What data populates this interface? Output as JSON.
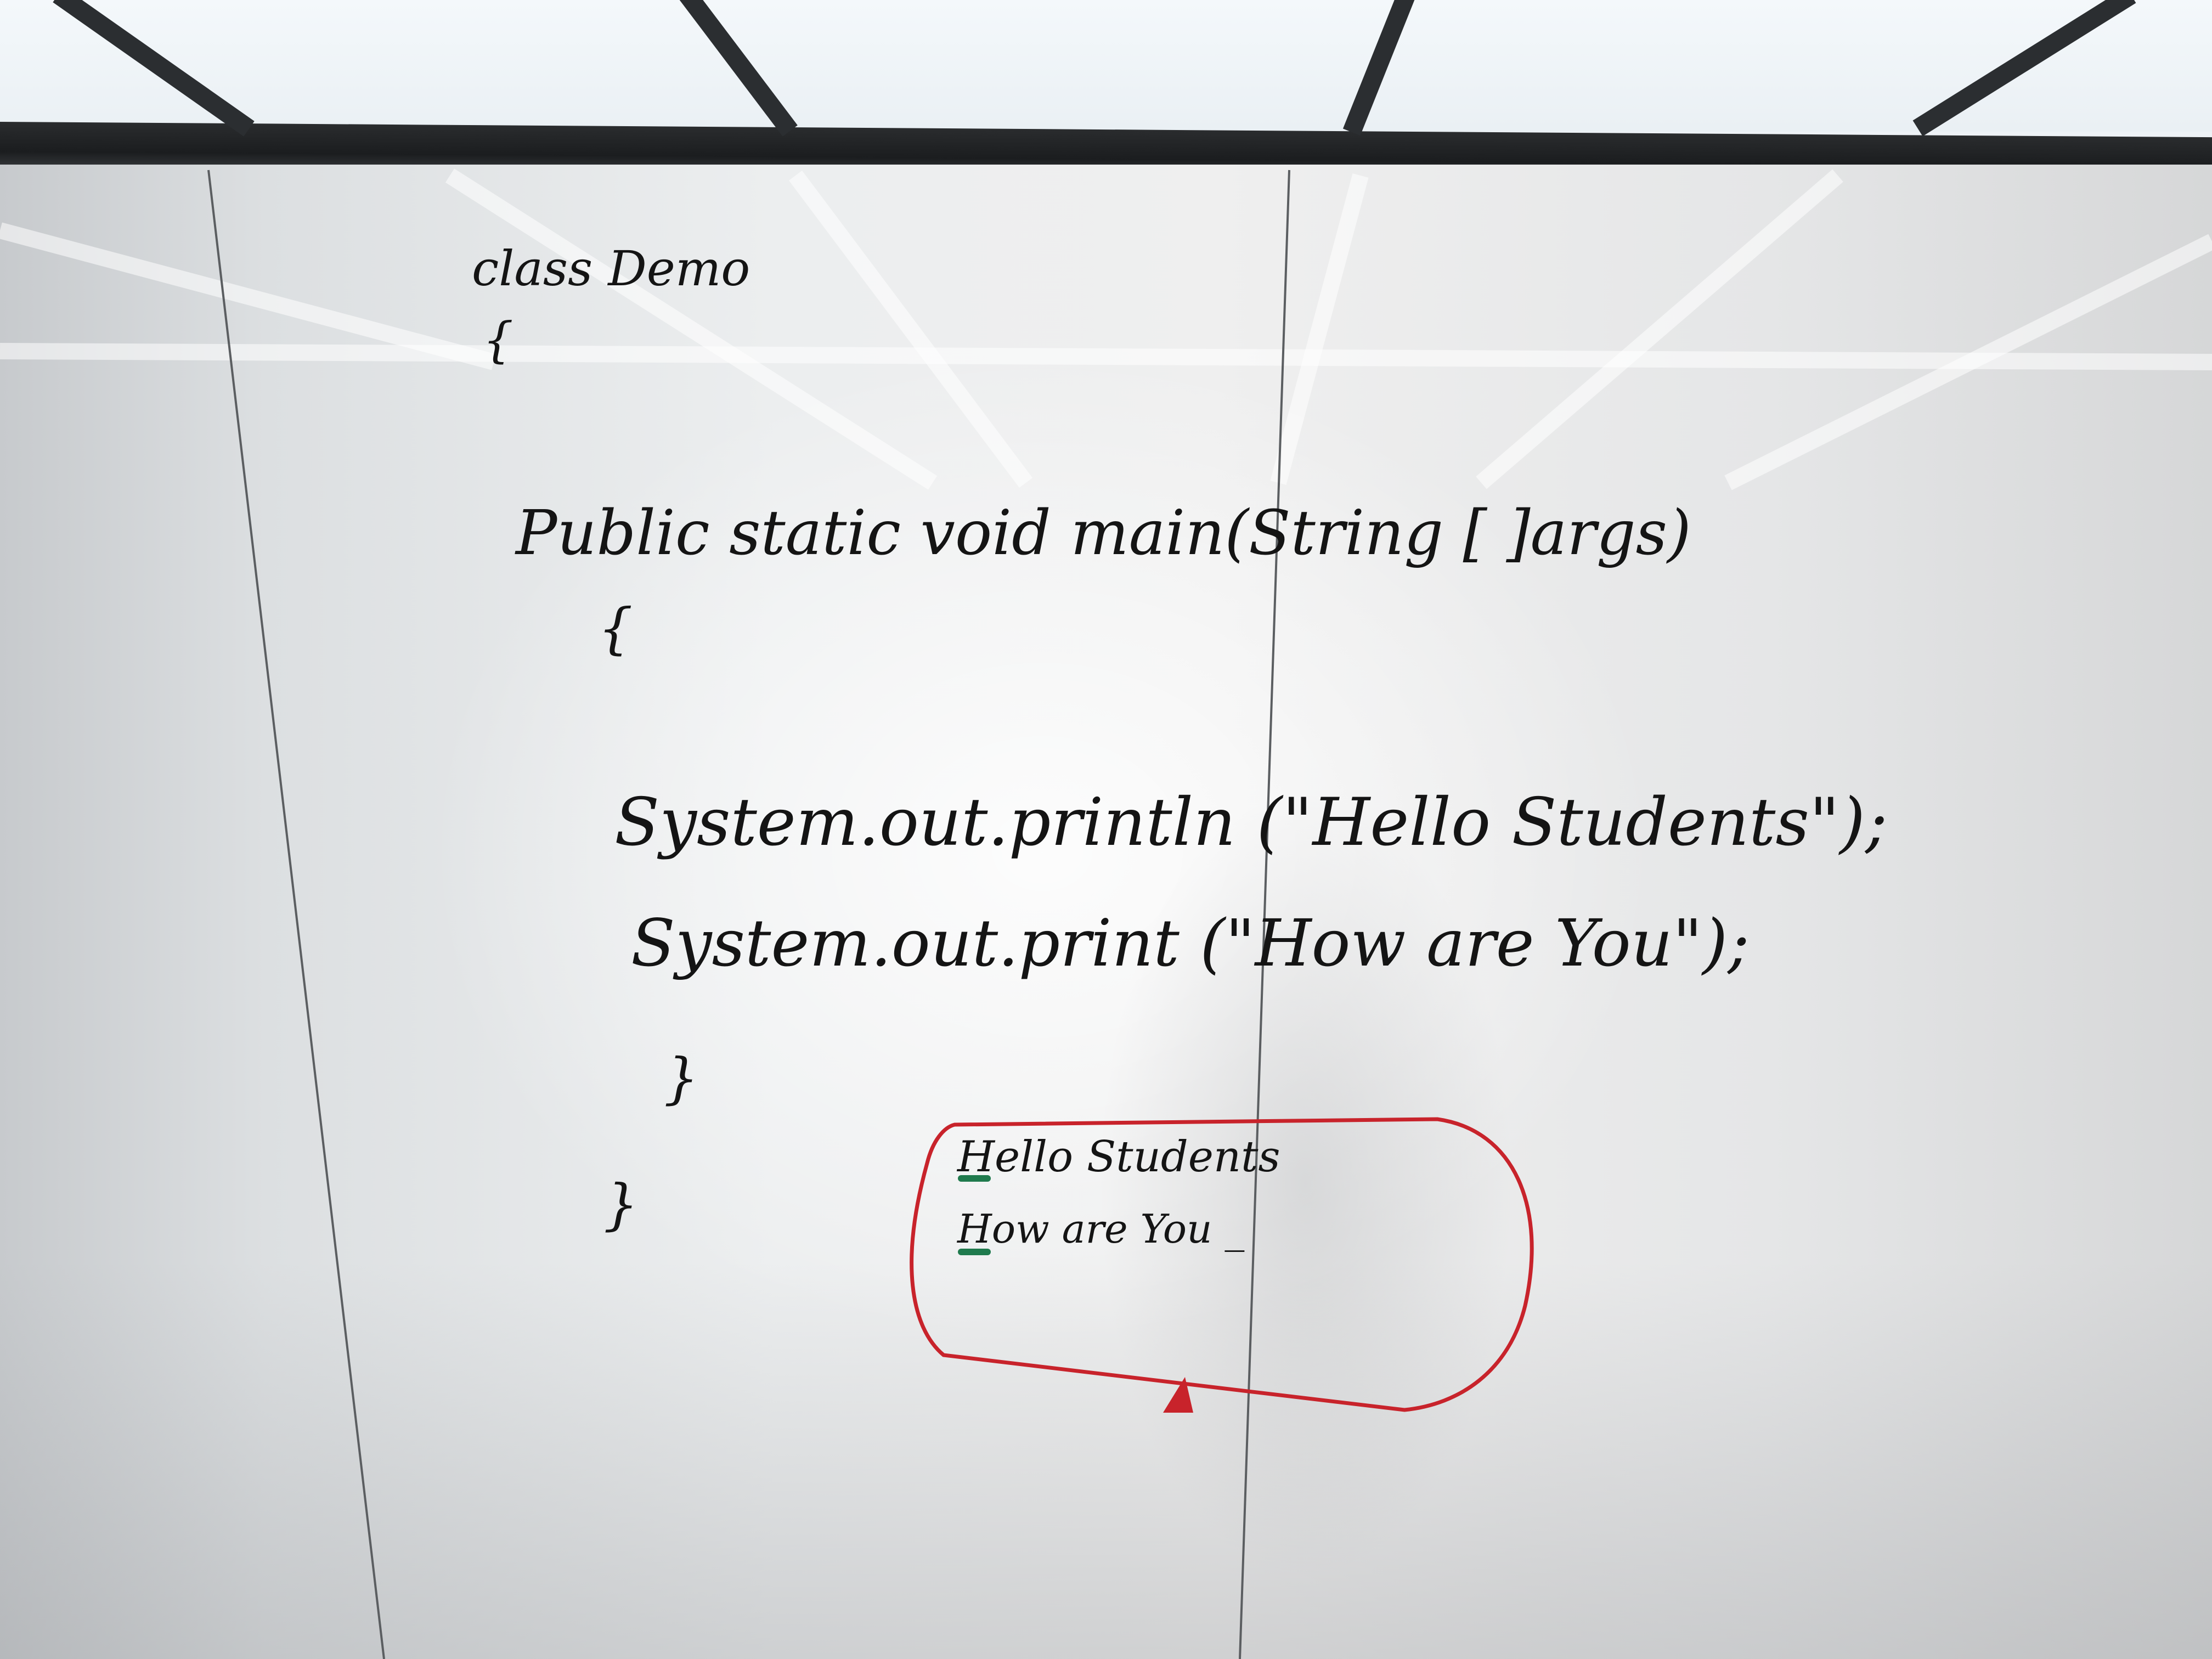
{
  "whiteboard": {
    "code_lines": [
      "class   Demo",
      "{",
      "Public  static  void  main(String  [ ]args)",
      "{",
      "System.out.println (\"Hello Students\");",
      "System.out.print  (\"How are You\");",
      "}",
      "}"
    ],
    "output_box": {
      "lines": [
        "Hello Students",
        "How are You _"
      ],
      "outline_color": "#c8232b",
      "cursor_mark_color": "#1f7a4d"
    },
    "ink_color": "#141414"
  }
}
